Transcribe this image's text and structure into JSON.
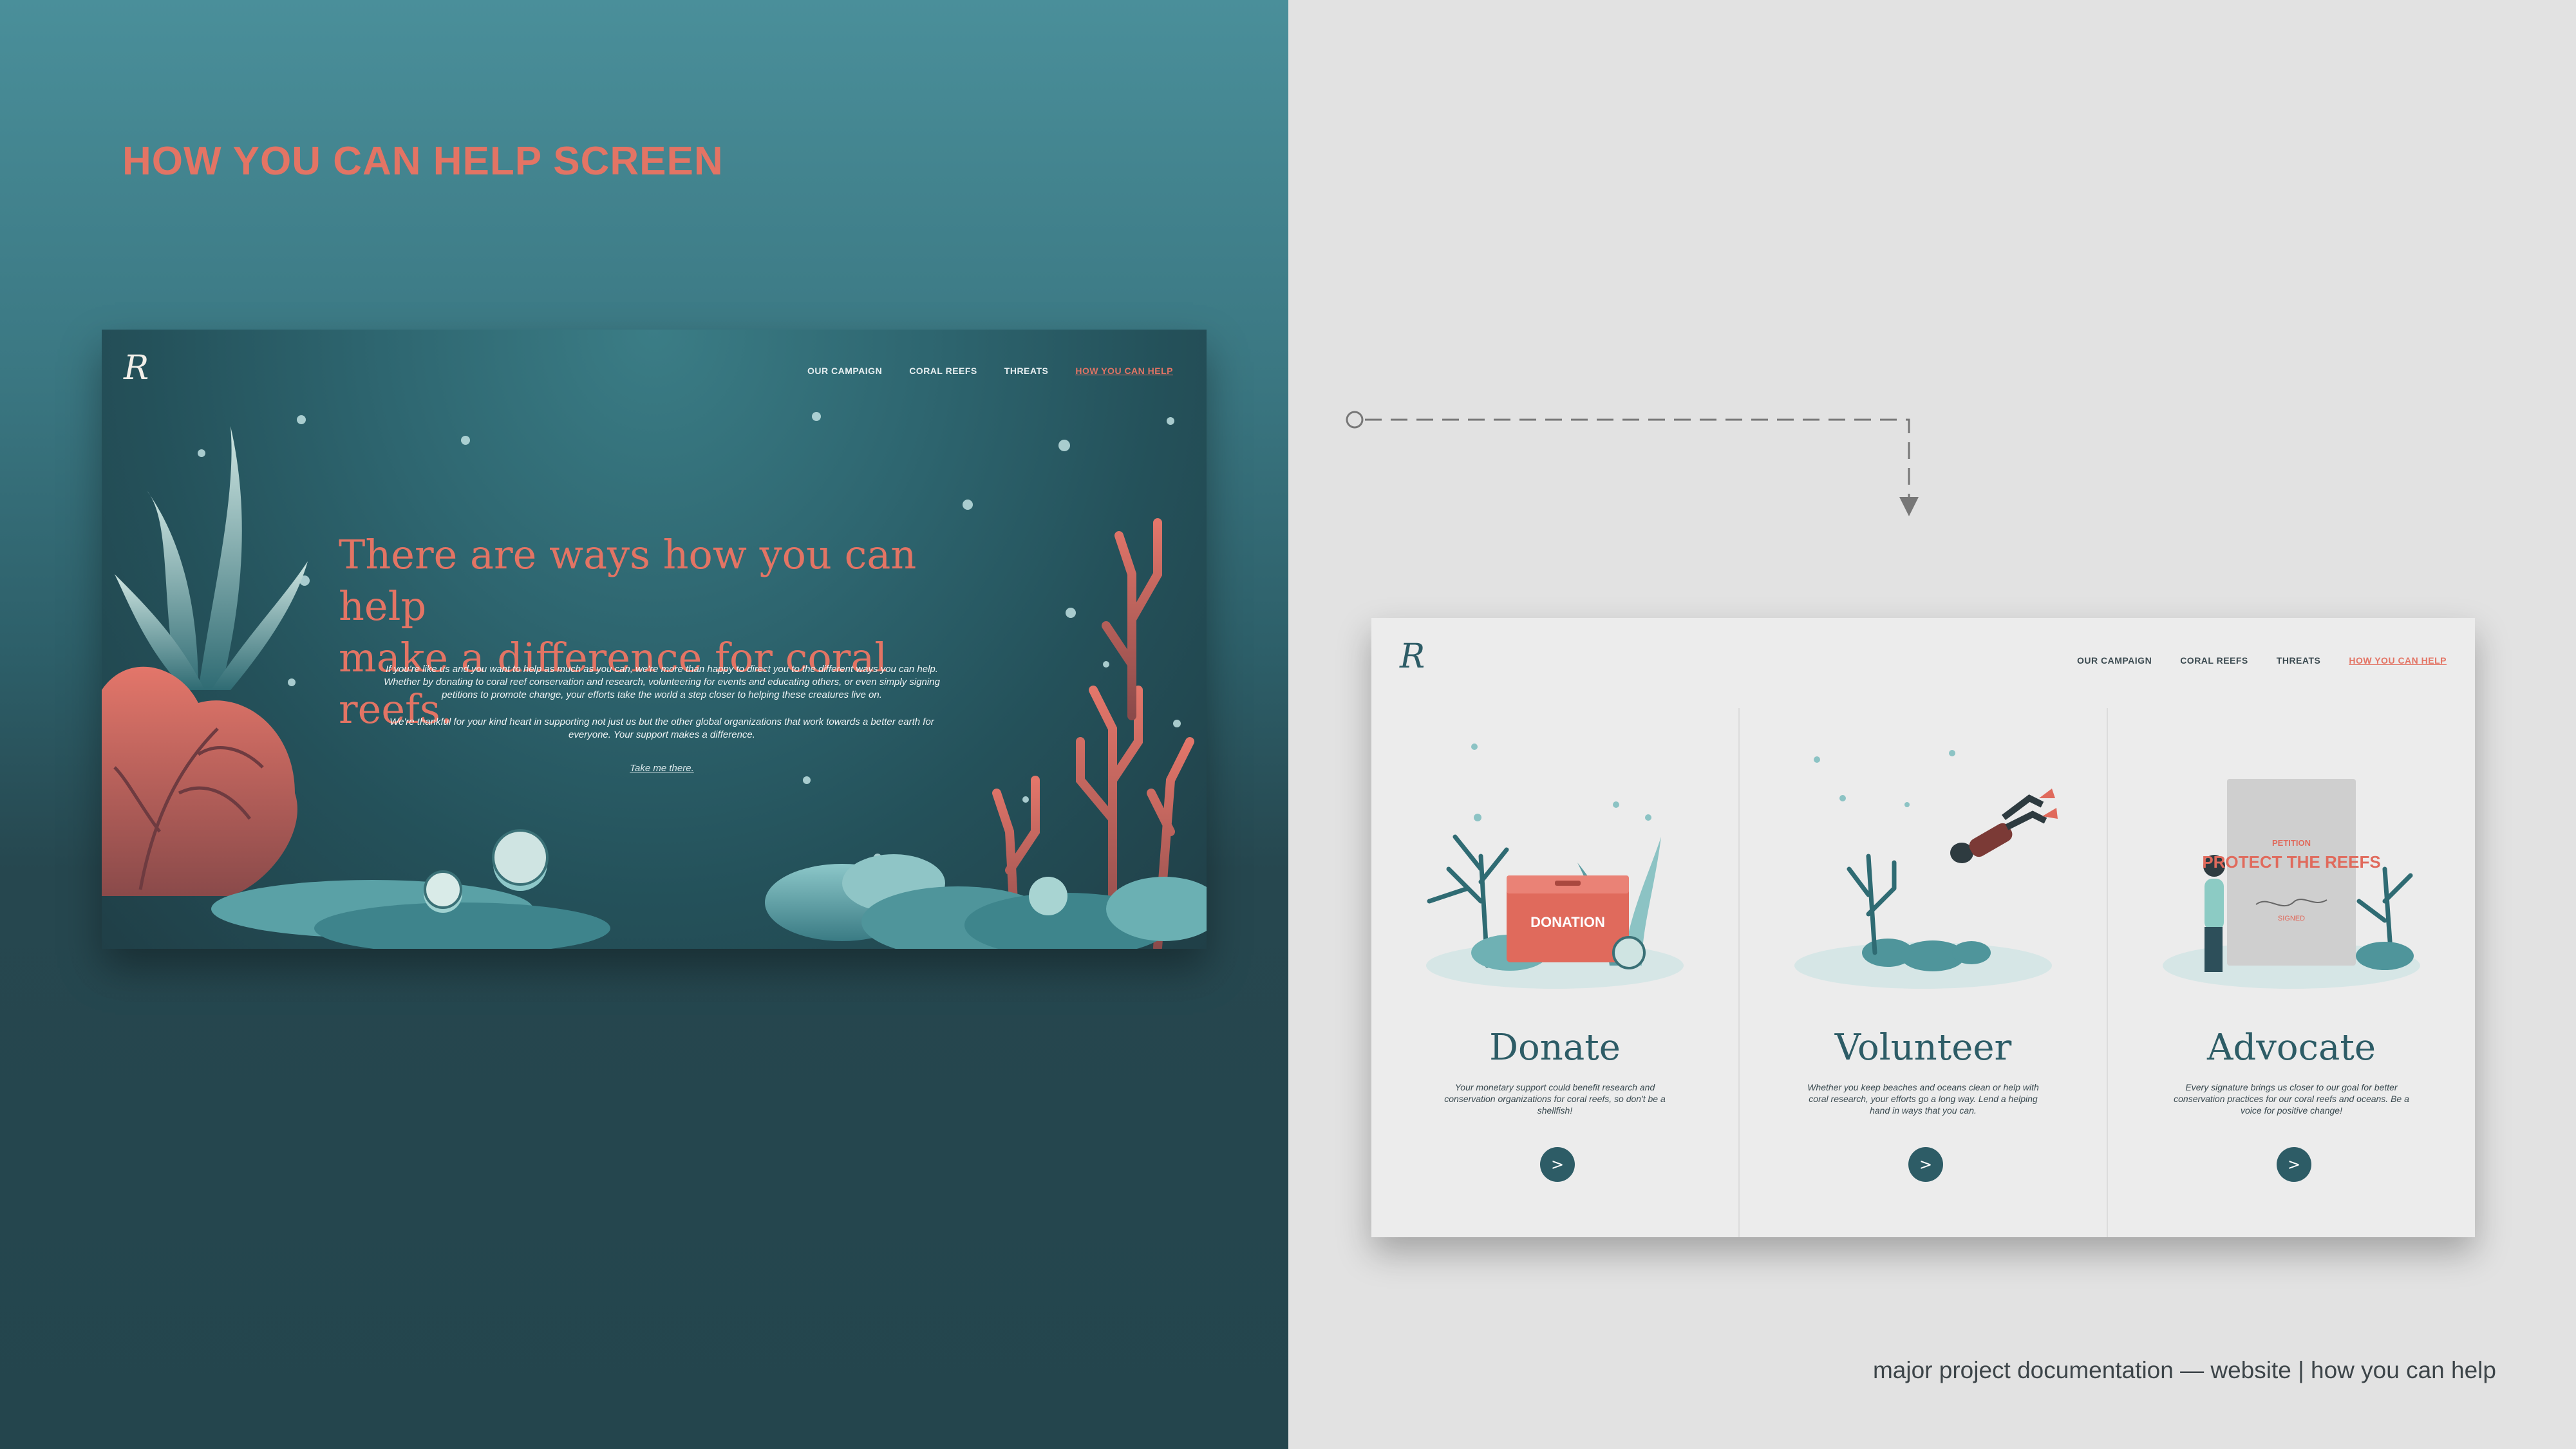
{
  "page": {
    "title": "HOW YOU CAN HELP SCREEN",
    "caption": "major project documentation — website | how you can help"
  },
  "colors": {
    "accent": "#e37464",
    "teal_dark": "#2d5c66",
    "left_bg": "#24454d",
    "right_bg": "#e2e2e2"
  },
  "nav": {
    "logo": "R",
    "items": [
      "OUR CAMPAIGN",
      "CORAL REEFS",
      "THREATS",
      "HOW YOU CAN HELP"
    ],
    "active": "HOW YOU CAN HELP"
  },
  "hero": {
    "heading_line1": "There are ways how you can help",
    "heading_line2": "make a difference for coral reefs.",
    "para1": "If you're like us and you want to help as much as you can, we're more than happy to direct you to the different ways you can help. Whether by donating to coral reef conservation and research, volunteering for events and educating others, or even simply signing petitions to promote change, your efforts take the world a step closer to helping these creatures live on.",
    "para2": "We're thankful for your kind heart in supporting not just us but the other global organizations that work towards a better earth for everyone. Your support makes a difference.",
    "link": "Take me there."
  },
  "cards": [
    {
      "title": "Donate",
      "description": "Your monetary support could benefit research and conservation organizations for coral reefs, so don't be a shellfish!",
      "illustration_label": "DONATION",
      "button": ">"
    },
    {
      "title": "Volunteer",
      "description": "Whether you keep beaches and oceans clean or help with coral research, your efforts go a long way. Lend a helping hand in ways that you can.",
      "button": ">"
    },
    {
      "title": "Advocate",
      "description": "Every signature brings us closer to our goal for better conservation practices for our coral reefs and oceans. Be a voice for positive change!",
      "illustration_label_top": "PETITION",
      "illustration_label_main": "PROTECT THE REEFS",
      "illustration_label_sub": "SIGNED",
      "button": ">"
    }
  ]
}
